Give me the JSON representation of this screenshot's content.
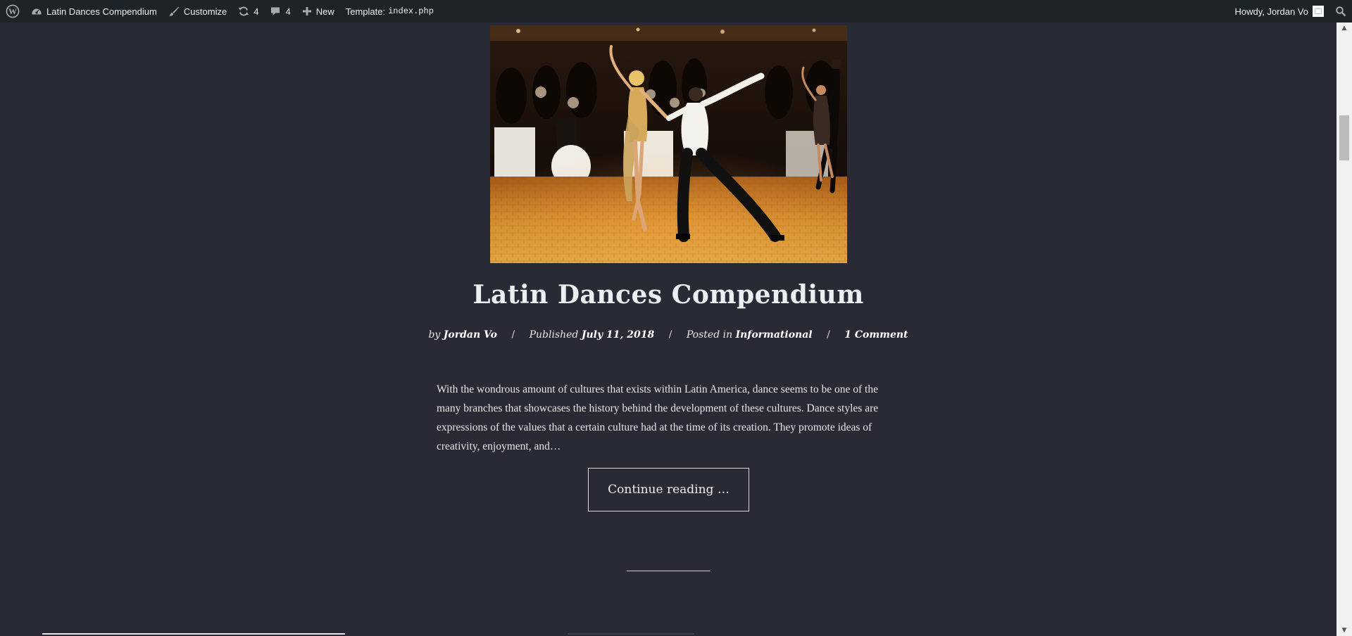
{
  "admin_bar": {
    "site_name": "Latin Dances Compendium",
    "customize": "Customize",
    "updates_count": "4",
    "comments_count": "4",
    "new_label": "New",
    "template_label": "Template:",
    "template_file": "index.php",
    "greeting": "Howdy, Jordan Vo"
  },
  "post": {
    "image_alt": "Latin ballroom dancers performing on a wooden floor before an audience",
    "title": "Latin Dances Compendium",
    "meta": {
      "by_prefix": "by",
      "author": "Jordan Vo",
      "published_prefix": "Published",
      "date": "July 11, 2018",
      "posted_prefix": "Posted in",
      "category": "Informational",
      "comments": "1 Comment"
    },
    "excerpt": "With the wondrous amount of cultures that exists within Latin America, dance seems to be one of the many branches that showcases the history behind the development of these cultures. Dance styles are expressions of the values that a certain culture had at the time of its creation. They promote ideas of creativity, enjoyment, and…",
    "continue_label": "Continue reading …"
  },
  "scrollbar": {
    "position_fraction": 0.15
  },
  "colors": {
    "background": "#282a36",
    "admin_bar": "#1d2327",
    "text": "#e6e6e6"
  }
}
